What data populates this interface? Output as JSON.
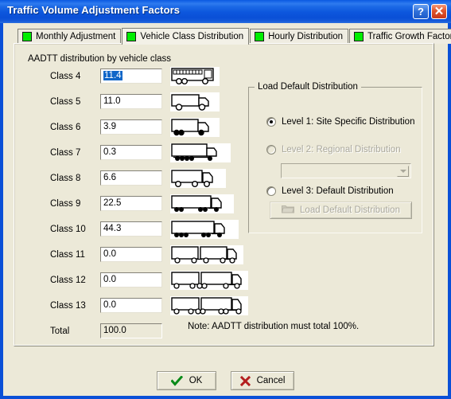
{
  "window": {
    "title": "Traffic Volume Adjustment Factors",
    "help_button": "?",
    "close_button": "✕"
  },
  "tabs": [
    {
      "label": "Monthly Adjustment",
      "chip_color": "#00ee00",
      "active": false
    },
    {
      "label": "Vehicle Class Distribution",
      "chip_color": "#00ee00",
      "active": true
    },
    {
      "label": "Hourly Distribution",
      "chip_color": "#00ee00",
      "active": false
    },
    {
      "label": "Traffic Growth Factors",
      "chip_color": "#00ee00",
      "active": false
    }
  ],
  "panel": {
    "section_title": "AADTT distribution by vehicle class",
    "note": "Note: AADTT distribution must total 100%.",
    "rows": [
      {
        "label": "Class 4",
        "value": "11.4",
        "selected": true,
        "readonly": false,
        "icon": "bus-icon"
      },
      {
        "label": "Class 5",
        "value": "11.0",
        "selected": false,
        "readonly": false,
        "icon": "single-unit-2-axle-truck-icon"
      },
      {
        "label": "Class 6",
        "value": "3.9",
        "selected": false,
        "readonly": false,
        "icon": "single-unit-3-axle-truck-icon"
      },
      {
        "label": "Class 7",
        "value": "0.3",
        "selected": false,
        "readonly": false,
        "icon": "single-unit-4-axle-truck-icon"
      },
      {
        "label": "Class 8",
        "value": "6.6",
        "selected": false,
        "readonly": false,
        "icon": "single-trailer-3-axle-truck-icon"
      },
      {
        "label": "Class 9",
        "value": "22.5",
        "selected": false,
        "readonly": false,
        "icon": "single-trailer-5-axle-truck-icon"
      },
      {
        "label": "Class 10",
        "value": "44.3",
        "selected": false,
        "readonly": false,
        "icon": "single-trailer-6-axle-truck-icon"
      },
      {
        "label": "Class 11",
        "value": "0.0",
        "selected": false,
        "readonly": false,
        "icon": "multi-trailer-5-axle-truck-icon"
      },
      {
        "label": "Class 12",
        "value": "0.0",
        "selected": false,
        "readonly": false,
        "icon": "multi-trailer-6-axle-truck-icon"
      },
      {
        "label": "Class 13",
        "value": "0.0",
        "selected": false,
        "readonly": false,
        "icon": "multi-trailer-7-axle-truck-icon"
      },
      {
        "label": "Total",
        "value": "100.0",
        "selected": false,
        "readonly": true,
        "icon": "none"
      }
    ]
  },
  "load_group": {
    "title": "Load Default Distribution",
    "options": [
      {
        "label": "Level 1: Site Specific Distribution",
        "checked": true,
        "disabled": false
      },
      {
        "label": "Level 2: Regional Distribution",
        "checked": false,
        "disabled": true
      },
      {
        "label": "Level 3: Default Distribution",
        "checked": false,
        "disabled": false
      }
    ],
    "combo_value": "",
    "load_button_label": "Load Default Distribution"
  },
  "footer": {
    "ok_label": "OK",
    "cancel_label": "Cancel"
  },
  "colors": {
    "titlebar_blue": "#0a50d7",
    "dialog_face": "#ece9d8",
    "tab_chip_green": "#00ee00",
    "selection_blue": "#1066c8",
    "ok_check_green": "#0a8a19",
    "cancel_x_red": "#b41f1f"
  }
}
